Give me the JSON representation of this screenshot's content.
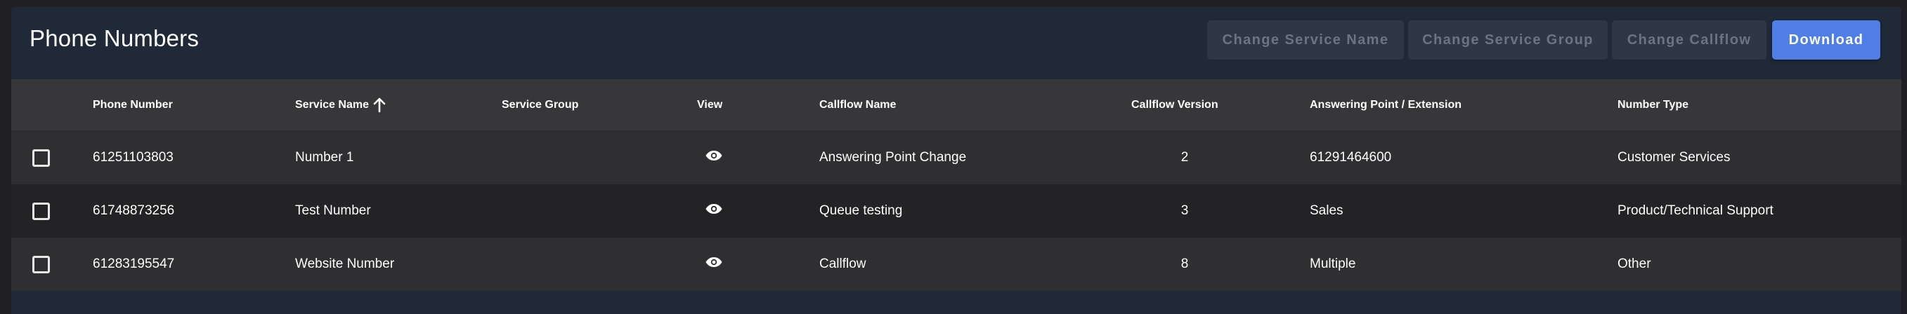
{
  "page": {
    "title": "Phone Numbers"
  },
  "toolbar": {
    "change_service_name": "Change Service Name",
    "change_service_group": "Change Service Group",
    "change_callflow": "Change Callflow",
    "download": "Download"
  },
  "table": {
    "columns": {
      "phone_number": "Phone Number",
      "service_name": "Service Name",
      "service_group": "Service Group",
      "view": "View",
      "callflow_name": "Callflow Name",
      "callflow_version": "Callflow Version",
      "answering_point": "Answering Point / Extension",
      "number_type": "Number Type"
    },
    "sort": {
      "column": "Service Name",
      "direction": "ascending",
      "icon": "arrow-up-icon"
    },
    "rows": [
      {
        "phone_number": "61251103803",
        "service_name": "Number 1",
        "service_group": "",
        "callflow_name": "Answering Point Change",
        "callflow_version": "2",
        "answering_point": "61291464600",
        "number_type": "Customer Services"
      },
      {
        "phone_number": "61748873256",
        "service_name": "Test Number",
        "service_group": "",
        "callflow_name": "Queue testing",
        "callflow_version": "3",
        "answering_point": "Sales",
        "number_type": "Product/Technical Support"
      },
      {
        "phone_number": "61283195547",
        "service_name": "Website Number",
        "service_group": "",
        "callflow_name": "Callflow",
        "callflow_version": "8",
        "answering_point": "Multiple",
        "number_type": "Other"
      }
    ]
  },
  "icons": {
    "view": "eye-icon",
    "select": "checkbox-icon"
  },
  "colors": {
    "panel_background": "#1f2938",
    "header_row": "#37373a",
    "row_odd": "#2f2f31",
    "row_even": "#232325",
    "primary_button": "#4f7ee6",
    "disabled_button": "#2f3744",
    "disabled_text": "#6b7482"
  }
}
